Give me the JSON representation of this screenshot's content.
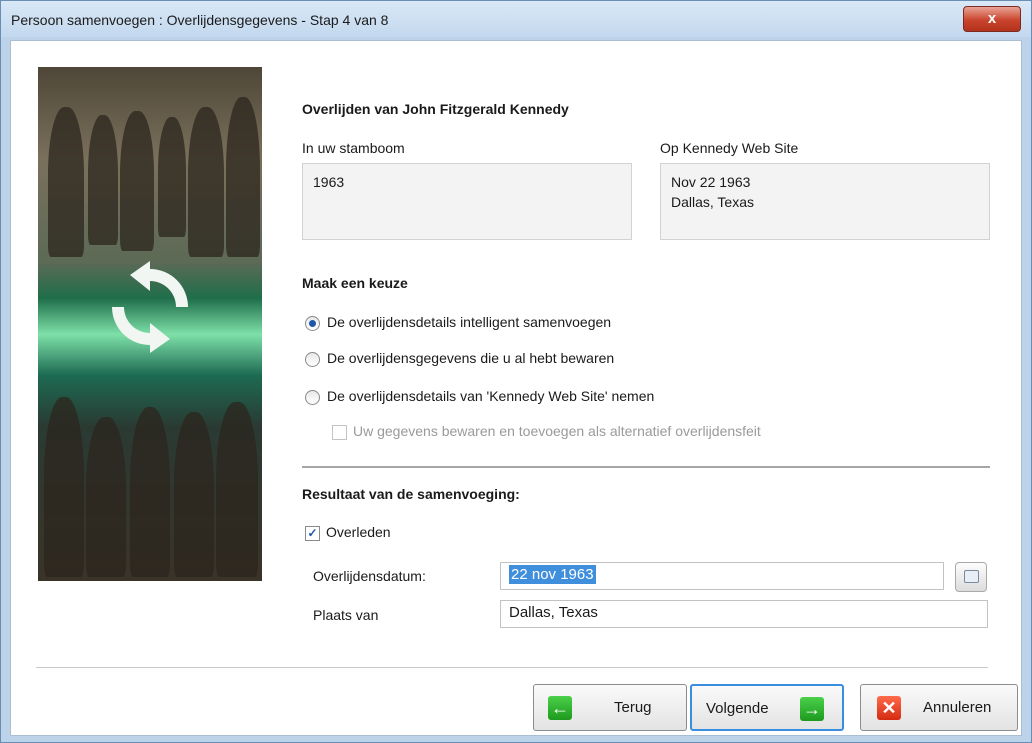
{
  "window": {
    "title": "Persoon samenvoegen : Overlijdensgegevens - Stap 4 van 8",
    "close_label": "x"
  },
  "heading": "Overlijden van John Fitzgerald Kennedy",
  "tree": {
    "label": "In uw stamboom",
    "lines": [
      "1963"
    ]
  },
  "web": {
    "label": "Op Kennedy Web Site",
    "lines": [
      "Nov 22 1963",
      "Dallas, Texas"
    ]
  },
  "choice": {
    "heading": "Maak een keuze",
    "options": [
      {
        "label": "De overlijdensdetails intelligent samenvoegen",
        "selected": true
      },
      {
        "label": "De overlijdensgegevens die u al hebt bewaren",
        "selected": false
      },
      {
        "label": "De overlijdensdetails van 'Kennedy Web Site' nemen",
        "selected": false
      }
    ],
    "sub_checkbox": {
      "label": "Uw gegevens bewaren en toevoegen als alternatief overlijdensfeit",
      "checked": false,
      "enabled": false
    }
  },
  "result": {
    "heading": "Resultaat van de samenvoeging:",
    "deceased": {
      "label": "Overleden",
      "checked": true
    },
    "date": {
      "label": "Overlijdensdatum:",
      "value": "22 nov 1963"
    },
    "place": {
      "label": "Plaats van",
      "value": "Dallas, Texas"
    }
  },
  "buttons": {
    "back": "Terug",
    "next": "Volgende",
    "cancel": "Annuleren"
  },
  "icons": {
    "back": "arrow-left-icon",
    "next": "arrow-right-icon",
    "cancel": "x-icon",
    "calendar": "calendar-icon",
    "merge": "sync-arrows-icon"
  }
}
